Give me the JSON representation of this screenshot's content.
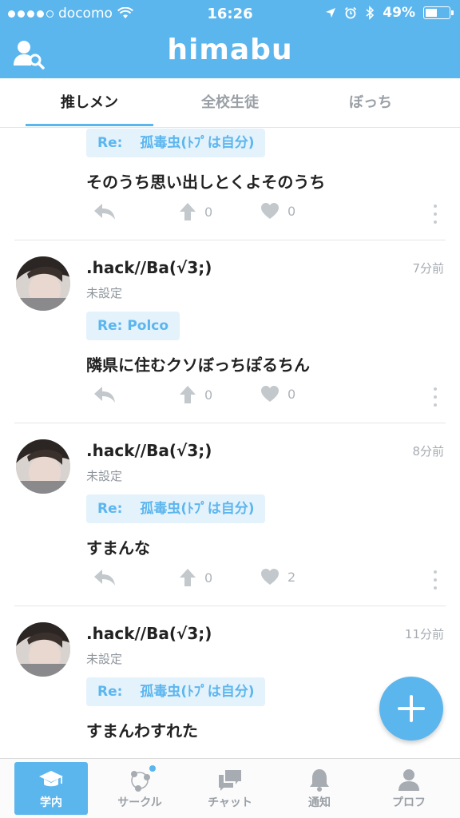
{
  "status_bar": {
    "carrier": "docomo",
    "time": "16:26",
    "battery": "49%"
  },
  "header": {
    "title": "himabu",
    "user_search_icon": "user-search-icon"
  },
  "tabs": [
    {
      "label": "推しメン",
      "active": true
    },
    {
      "label": "全校生徒",
      "active": false
    },
    {
      "label": "ぼっち",
      "active": false
    }
  ],
  "posts": [
    {
      "re_prefix": "Re:",
      "re_target": "孤毒虫(ﾄﾌﾟは自分)",
      "body": "そのうち思い出しとくよそのうち",
      "up_count": "0",
      "like_count": "0"
    },
    {
      "author": ".hack//Ba(√3;)",
      "affiliation": "未設定",
      "time": "7分前",
      "re_prefix": "Re: Polco",
      "re_target": "",
      "body": "隣県に住むクソぼっちぽるちん",
      "up_count": "0",
      "like_count": "0"
    },
    {
      "author": ".hack//Ba(√3;)",
      "affiliation": "未設定",
      "time": "8分前",
      "re_prefix": "Re:",
      "re_target": "孤毒虫(ﾄﾌﾟは自分)",
      "body": "すまんな",
      "up_count": "0",
      "like_count": "2"
    },
    {
      "author": ".hack//Ba(√3;)",
      "affiliation": "未設定",
      "time": "11分前",
      "re_prefix": "Re:",
      "re_target": "孤毒虫(ﾄﾌﾟは自分)",
      "body": "すまんわすれた"
    }
  ],
  "bottom_nav": [
    {
      "label": "学内",
      "icon": "graduation-cap-icon",
      "active": true
    },
    {
      "label": "サークル",
      "icon": "circle-network-icon",
      "active": false
    },
    {
      "label": "チャット",
      "icon": "chat-icon",
      "active": false
    },
    {
      "label": "通知",
      "icon": "bell-icon",
      "active": false
    },
    {
      "label": "プロフ",
      "icon": "profile-icon",
      "active": false
    }
  ],
  "colors": {
    "accent": "#5cb6ee",
    "badge_bg": "#e4f2fc",
    "muted": "#aeb4ba"
  }
}
